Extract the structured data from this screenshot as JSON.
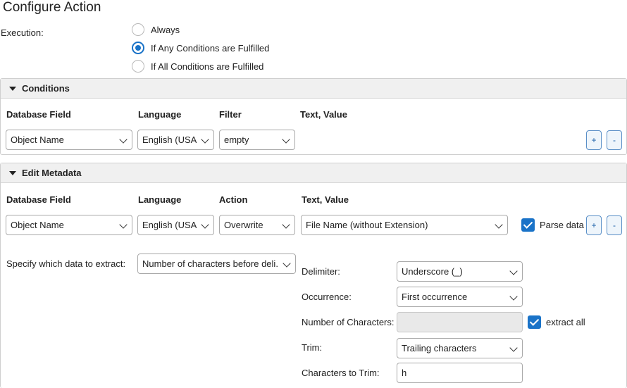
{
  "title": "Configure Action",
  "execution": {
    "label": "Execution:",
    "options": [
      "Always",
      "If Any Conditions are Fulfilled",
      "If All Conditions are Fulfilled"
    ],
    "selected": "If Any Conditions are Fulfilled"
  },
  "conditions": {
    "header": "Conditions",
    "columns": [
      "Database Field",
      "Language",
      "Filter",
      "Text, Value"
    ],
    "row": {
      "field": "Object Name",
      "language": "English (USA)",
      "filter": "empty"
    },
    "add_label": "+",
    "remove_label": "-"
  },
  "edit_metadata": {
    "header": "Edit Metadata",
    "columns": [
      "Database Field",
      "Language",
      "Action",
      "Text, Value"
    ],
    "row": {
      "field": "Object Name",
      "language": "English (USA)",
      "action": "Overwrite",
      "value": "File Name (without Extension)",
      "parse_label": "Parse data",
      "parse_checked": true
    },
    "add_label": "+",
    "remove_label": "-",
    "extract": {
      "label": "Specify which data to extract:",
      "value": "Number of characters before deli..."
    },
    "delimiter": {
      "label": "Delimiter:",
      "value": "Underscore (_)"
    },
    "occurrence": {
      "label": "Occurrence:",
      "value": "First occurrence"
    },
    "num_chars": {
      "label": "Number of Characters:",
      "value": "",
      "extract_all_label": "extract all",
      "extract_all_checked": true
    },
    "trim": {
      "label": "Trim:",
      "value": "Trailing characters"
    },
    "chars_to_trim": {
      "label": "Characters to Trim:",
      "value": "h"
    }
  },
  "colors": {
    "accent": "#1a73c8",
    "header_bg": "#f0f0f0"
  }
}
